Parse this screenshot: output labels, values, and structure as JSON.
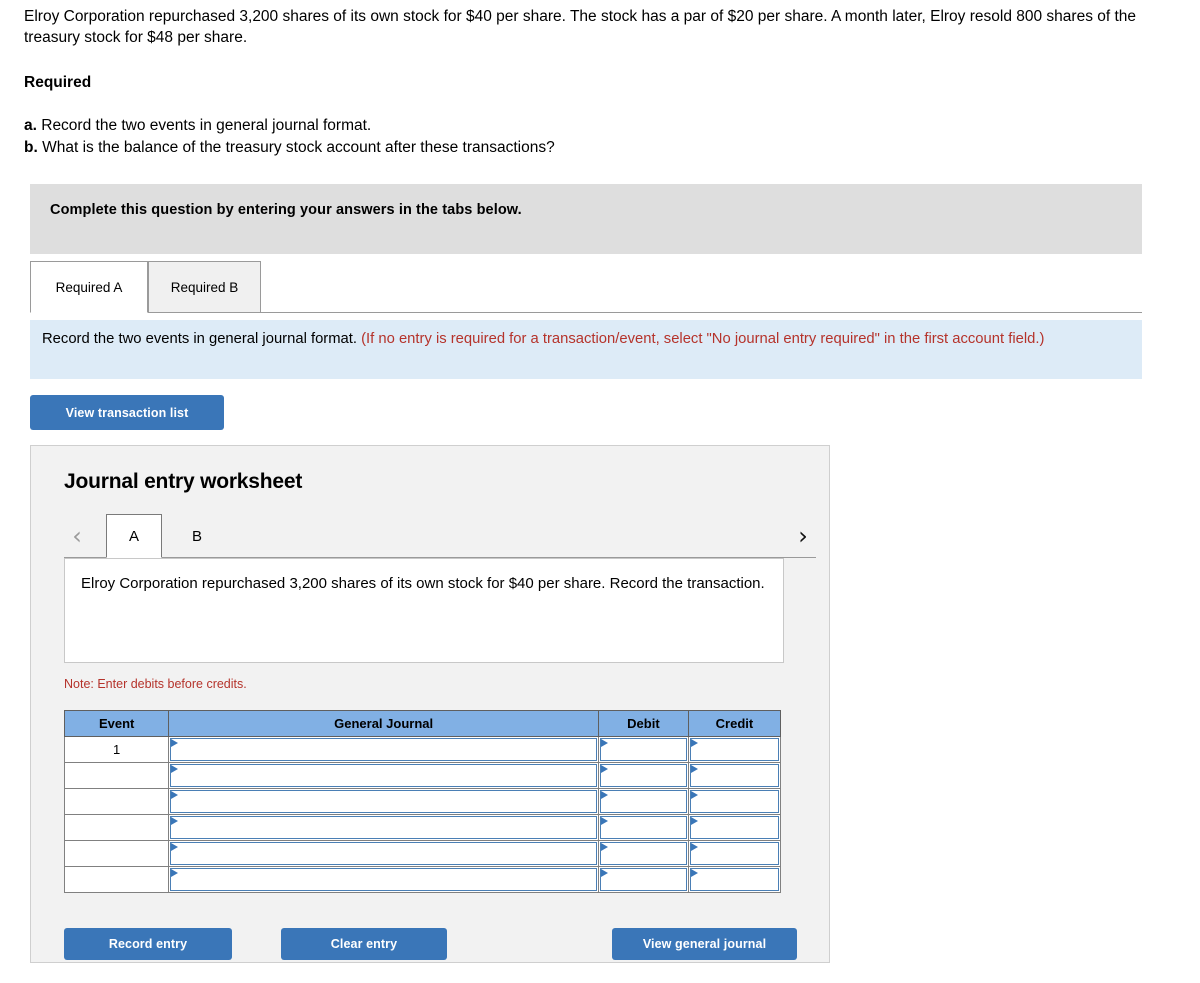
{
  "problem": {
    "statement": "Elroy Corporation repurchased 3,200 shares of its own stock for $40 per share. The stock has a par of $20 per share. A month later, Elroy resold 800 shares of the treasury stock for $48 per share.",
    "required_heading": "Required",
    "item_a_label": "a.",
    "item_a_text": " Record the two events in general journal format.",
    "item_b_label": "b.",
    "item_b_text": " What is the balance of the treasury stock account after these transactions?"
  },
  "gray_banner": {
    "text": "Complete this question by entering your answers in the tabs below."
  },
  "tabs": [
    {
      "label": "Required A",
      "active": true
    },
    {
      "label": "Required B",
      "active": false
    }
  ],
  "blue_banner": {
    "black_text": "Record the two events in general journal format. ",
    "red_text": "(If no entry is required for a transaction/event, select \"No journal entry required\" in the first account field.)"
  },
  "buttons": {
    "view_transaction_list": "View transaction list",
    "record_entry": "Record entry",
    "clear_entry": "Clear entry",
    "view_general_journal": "View general journal"
  },
  "worksheet": {
    "title": "Journal entry worksheet",
    "prev_chevron": "‹",
    "next_chevron": "›",
    "subtabs": [
      {
        "label": "A",
        "active": true
      },
      {
        "label": "B",
        "active": false
      }
    ],
    "transaction_text": "Elroy Corporation repurchased 3,200 shares of its own stock for $40 per share. Record the transaction.",
    "note": "Note: Enter debits before credits.",
    "table": {
      "headers": [
        "Event",
        "General Journal",
        "Debit",
        "Credit"
      ],
      "rows": [
        {
          "event": "1",
          "general_journal": "",
          "debit": "",
          "credit": ""
        },
        {
          "event": "",
          "general_journal": "",
          "debit": "",
          "credit": ""
        },
        {
          "event": "",
          "general_journal": "",
          "debit": "",
          "credit": ""
        },
        {
          "event": "",
          "general_journal": "",
          "debit": "",
          "credit": ""
        },
        {
          "event": "",
          "general_journal": "",
          "debit": "",
          "credit": ""
        },
        {
          "event": "",
          "general_journal": "",
          "debit": "",
          "credit": ""
        }
      ]
    }
  },
  "colors": {
    "button_blue": "#3a76b8",
    "table_header_blue": "#81b0e4",
    "gray_banner": "#dedede",
    "blue_banner": "#ddebf7",
    "red_text": "#b5332b",
    "panel_bg": "#f2f2f2"
  }
}
